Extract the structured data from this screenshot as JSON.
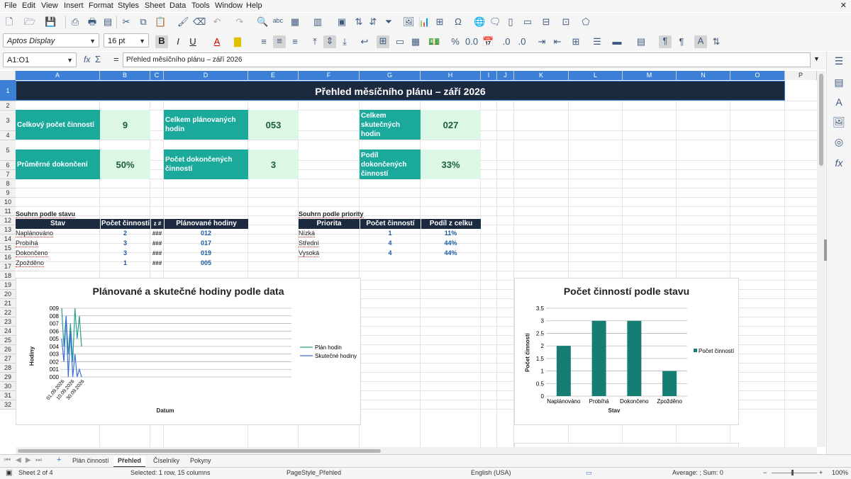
{
  "menu": [
    "File",
    "Edit",
    "View",
    "Insert",
    "Format",
    "Styles",
    "Sheet",
    "Data",
    "Tools",
    "Window",
    "Help"
  ],
  "font": {
    "name": "Aptos Display",
    "size": "16 pt"
  },
  "namebox": "A1:O1",
  "formula_content": "Přehled měsíčního plánu – září 2026",
  "columns": [
    "A",
    "B",
    "C",
    "D",
    "E",
    "F",
    "G",
    "H",
    "I",
    "J",
    "K",
    "L",
    "M",
    "N",
    "O",
    "P"
  ],
  "rows": [
    "1",
    "2",
    "3",
    "4",
    "5",
    "6",
    "7",
    "8",
    "9",
    "10",
    "11",
    "12",
    "13",
    "14",
    "15",
    "16",
    "17",
    "18",
    "19",
    "20",
    "21",
    "22",
    "23",
    "24",
    "25",
    "26",
    "27",
    "28",
    "29",
    "30",
    "31",
    "32"
  ],
  "title": "Přehled měsíčního plánu – září 2026",
  "kpis": [
    {
      "label": "Celkový počet činností",
      "value": "9"
    },
    {
      "label": "Celkem plánovaných hodin",
      "value": "053"
    },
    {
      "label": "Celkem skutečných hodin",
      "value": "027"
    },
    {
      "label": "Průměrné dokončení",
      "value": "50%"
    },
    {
      "label": "Počet dokončených činností",
      "value": "3"
    },
    {
      "label": "Podíl dokončených činností",
      "value": "33%"
    }
  ],
  "status_summary": {
    "heading": "Souhrn podle stavu",
    "headers": [
      "Stav",
      "Počet činností",
      "z #",
      "Plánované hodiny"
    ],
    "rows": [
      [
        "Naplánováno",
        "2",
        "###",
        "012"
      ],
      [
        "Probíhá",
        "3",
        "###",
        "017"
      ],
      [
        "Dokončeno",
        "3",
        "###",
        "019"
      ],
      [
        "Zpožděno",
        "1",
        "###",
        "005"
      ]
    ]
  },
  "priority_summary": {
    "heading": "Souhrn podle priority",
    "headers": [
      "Priorita",
      "Počet činností",
      "Podíl z celku"
    ],
    "rows": [
      [
        "Nízká",
        "1",
        "11%"
      ],
      [
        "Střední",
        "4",
        "44%"
      ],
      [
        "Vysoká",
        "4",
        "44%"
      ]
    ]
  },
  "line_chart": {
    "title": "Plánované a skutečné hodiny podle data",
    "xlabel": "Datum",
    "ylabel": "Hodiny",
    "yticks": [
      "009",
      "008",
      "007",
      "006",
      "005",
      "004",
      "003",
      "002",
      "001",
      "000"
    ],
    "xticks": [
      "01.09.2026",
      "10.09.2026",
      "30.09.2026"
    ],
    "legend": [
      "Plán hodin",
      "Skutečné hodiny"
    ],
    "colors": [
      "#2a9d8f",
      "#3b6fd6"
    ]
  },
  "bar_chart": {
    "title": "Počet činností podle stavu",
    "xlabel": "Stav",
    "ylabel": "Počet činností",
    "legend": "Počet činností",
    "color": "#167d72"
  },
  "chart_data": [
    {
      "type": "line",
      "title": "Plánované a skutečné hodiny podle data",
      "xlabel": "Datum",
      "ylabel": "Hodiny",
      "ylim": [
        0,
        9
      ],
      "series": [
        {
          "name": "Plán hodin",
          "values": [
            9,
            4,
            8,
            3,
            7,
            2,
            9,
            5,
            8,
            4
          ]
        },
        {
          "name": "Skutečné hodiny",
          "values": [
            5,
            2,
            8,
            0,
            6,
            0,
            3,
            0,
            1,
            0
          ]
        }
      ]
    },
    {
      "type": "bar",
      "title": "Počet činností podle stavu",
      "xlabel": "Stav",
      "ylabel": "Počet činností",
      "categories": [
        "Naplánováno",
        "Probíhá",
        "Dokončeno",
        "Zpožděno"
      ],
      "series": [
        {
          "name": "Počet činností",
          "values": [
            2,
            3,
            3,
            1
          ]
        }
      ],
      "ylim": [
        0,
        3.5
      ],
      "yticks": [
        "0",
        "0.5",
        "1",
        "1.5",
        "2",
        "2.5",
        "3",
        "3.5"
      ]
    }
  ],
  "sheet_tabs": [
    "Plán činností",
    "Přehled",
    "Číselníky",
    "Pokyny"
  ],
  "status": {
    "sheet": "Sheet 2 of 4",
    "selection": "Selected: 1 row, 15 columns",
    "pagestyle": "PageStyle_Přehled",
    "language": "English (USA)",
    "summary": "Average: ; Sum: 0",
    "zoom": "100%"
  }
}
